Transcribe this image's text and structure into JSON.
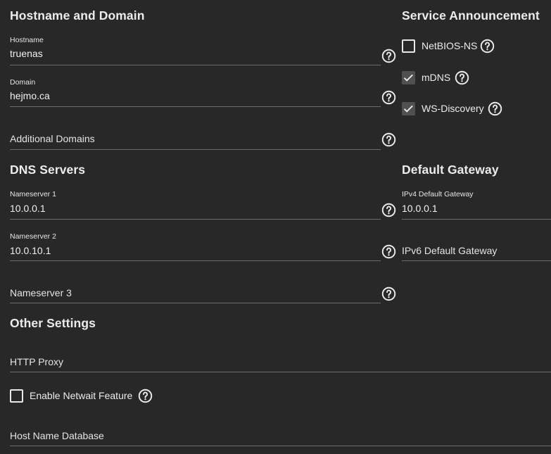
{
  "hostname_domain": {
    "title": "Hostname and Domain",
    "hostname": {
      "label": "Hostname",
      "value": "truenas"
    },
    "domain": {
      "label": "Domain",
      "value": "hejmo.ca"
    },
    "additional_domains": {
      "placeholder": "Additional Domains"
    }
  },
  "service_announcement": {
    "title": "Service Announcement",
    "items": [
      {
        "label": "NetBIOS-NS",
        "checked": false
      },
      {
        "label": "mDNS",
        "checked": true
      },
      {
        "label": "WS-Discovery",
        "checked": true
      }
    ]
  },
  "dns_servers": {
    "title": "DNS Servers",
    "nameserver1": {
      "label": "Nameserver 1",
      "value": "10.0.0.1"
    },
    "nameserver2": {
      "label": "Nameserver 2",
      "value": "10.0.10.1"
    },
    "nameserver3": {
      "placeholder": "Nameserver 3"
    }
  },
  "default_gateway": {
    "title": "Default Gateway",
    "ipv4": {
      "label": "IPv4 Default Gateway",
      "value": "10.0.0.1"
    },
    "ipv6": {
      "placeholder": "IPv6 Default Gateway"
    }
  },
  "other_settings": {
    "title": "Other Settings",
    "http_proxy": {
      "placeholder": "HTTP Proxy"
    },
    "netwait": {
      "label": "Enable Netwait Feature",
      "checked": false
    },
    "host_name_database": {
      "placeholder": "Host Name Database"
    }
  },
  "icons": {
    "help": "help-circle-icon",
    "check": "check-icon"
  },
  "colors": {
    "background": "#282828",
    "text": "#ececec",
    "underline": "#6c6c6c",
    "checkbox_checked_bg": "#505050"
  }
}
